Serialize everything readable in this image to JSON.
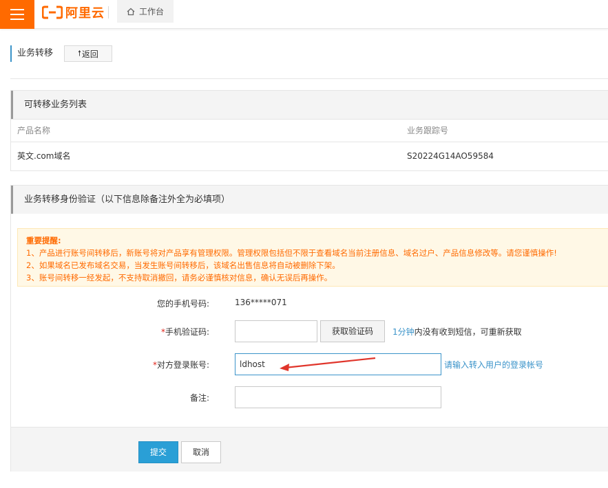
{
  "topbar": {
    "logo_text": "阿里云",
    "workbench_label": "工作台",
    "brand_color": "#ff6a00"
  },
  "page": {
    "title": "业务转移",
    "back_label": "返回"
  },
  "list": {
    "title": "可转移业务列表",
    "columns": [
      "产品名称",
      "业务跟踪号"
    ],
    "rows": [
      {
        "product": "英文.com域名",
        "tracking": "S20224G14AO59584"
      }
    ]
  },
  "verify": {
    "title": "业务转移身份验证（以下信息除备注外全为必填项）",
    "notice_title": "重要提醒:",
    "notice_lines": [
      "1、产品进行账号间转移后，新账号将对产品享有管理权限。管理权限包括但不限于查看域名当前注册信息、域名过户、产品信息修改等。请您谨慎操作!",
      "2、如果域名已发布域名交易，当发生账号间转移后，该域名出售信息将自动被删除下架。",
      "3、账号间转移一经发起，不支持取消撤回，请务必谨慎核对信息，确认无误后再操作。"
    ],
    "phone_label": "您的手机号码:",
    "phone_value": "136*****071",
    "sms_label": "手机验证码:",
    "sms_value": "",
    "sms_button": "获取验证码",
    "sms_hint_highlight": "1分钟",
    "sms_hint_rest": "内没有收到短信，可重新获取",
    "account_label": "对方登录账号:",
    "account_value": "ldhost",
    "account_hint": "请输入转入用户的登录帐号",
    "remark_label": "备注:",
    "remark_value": "",
    "required_mark": "*",
    "submit_label": "提交",
    "cancel_label": "取消"
  }
}
